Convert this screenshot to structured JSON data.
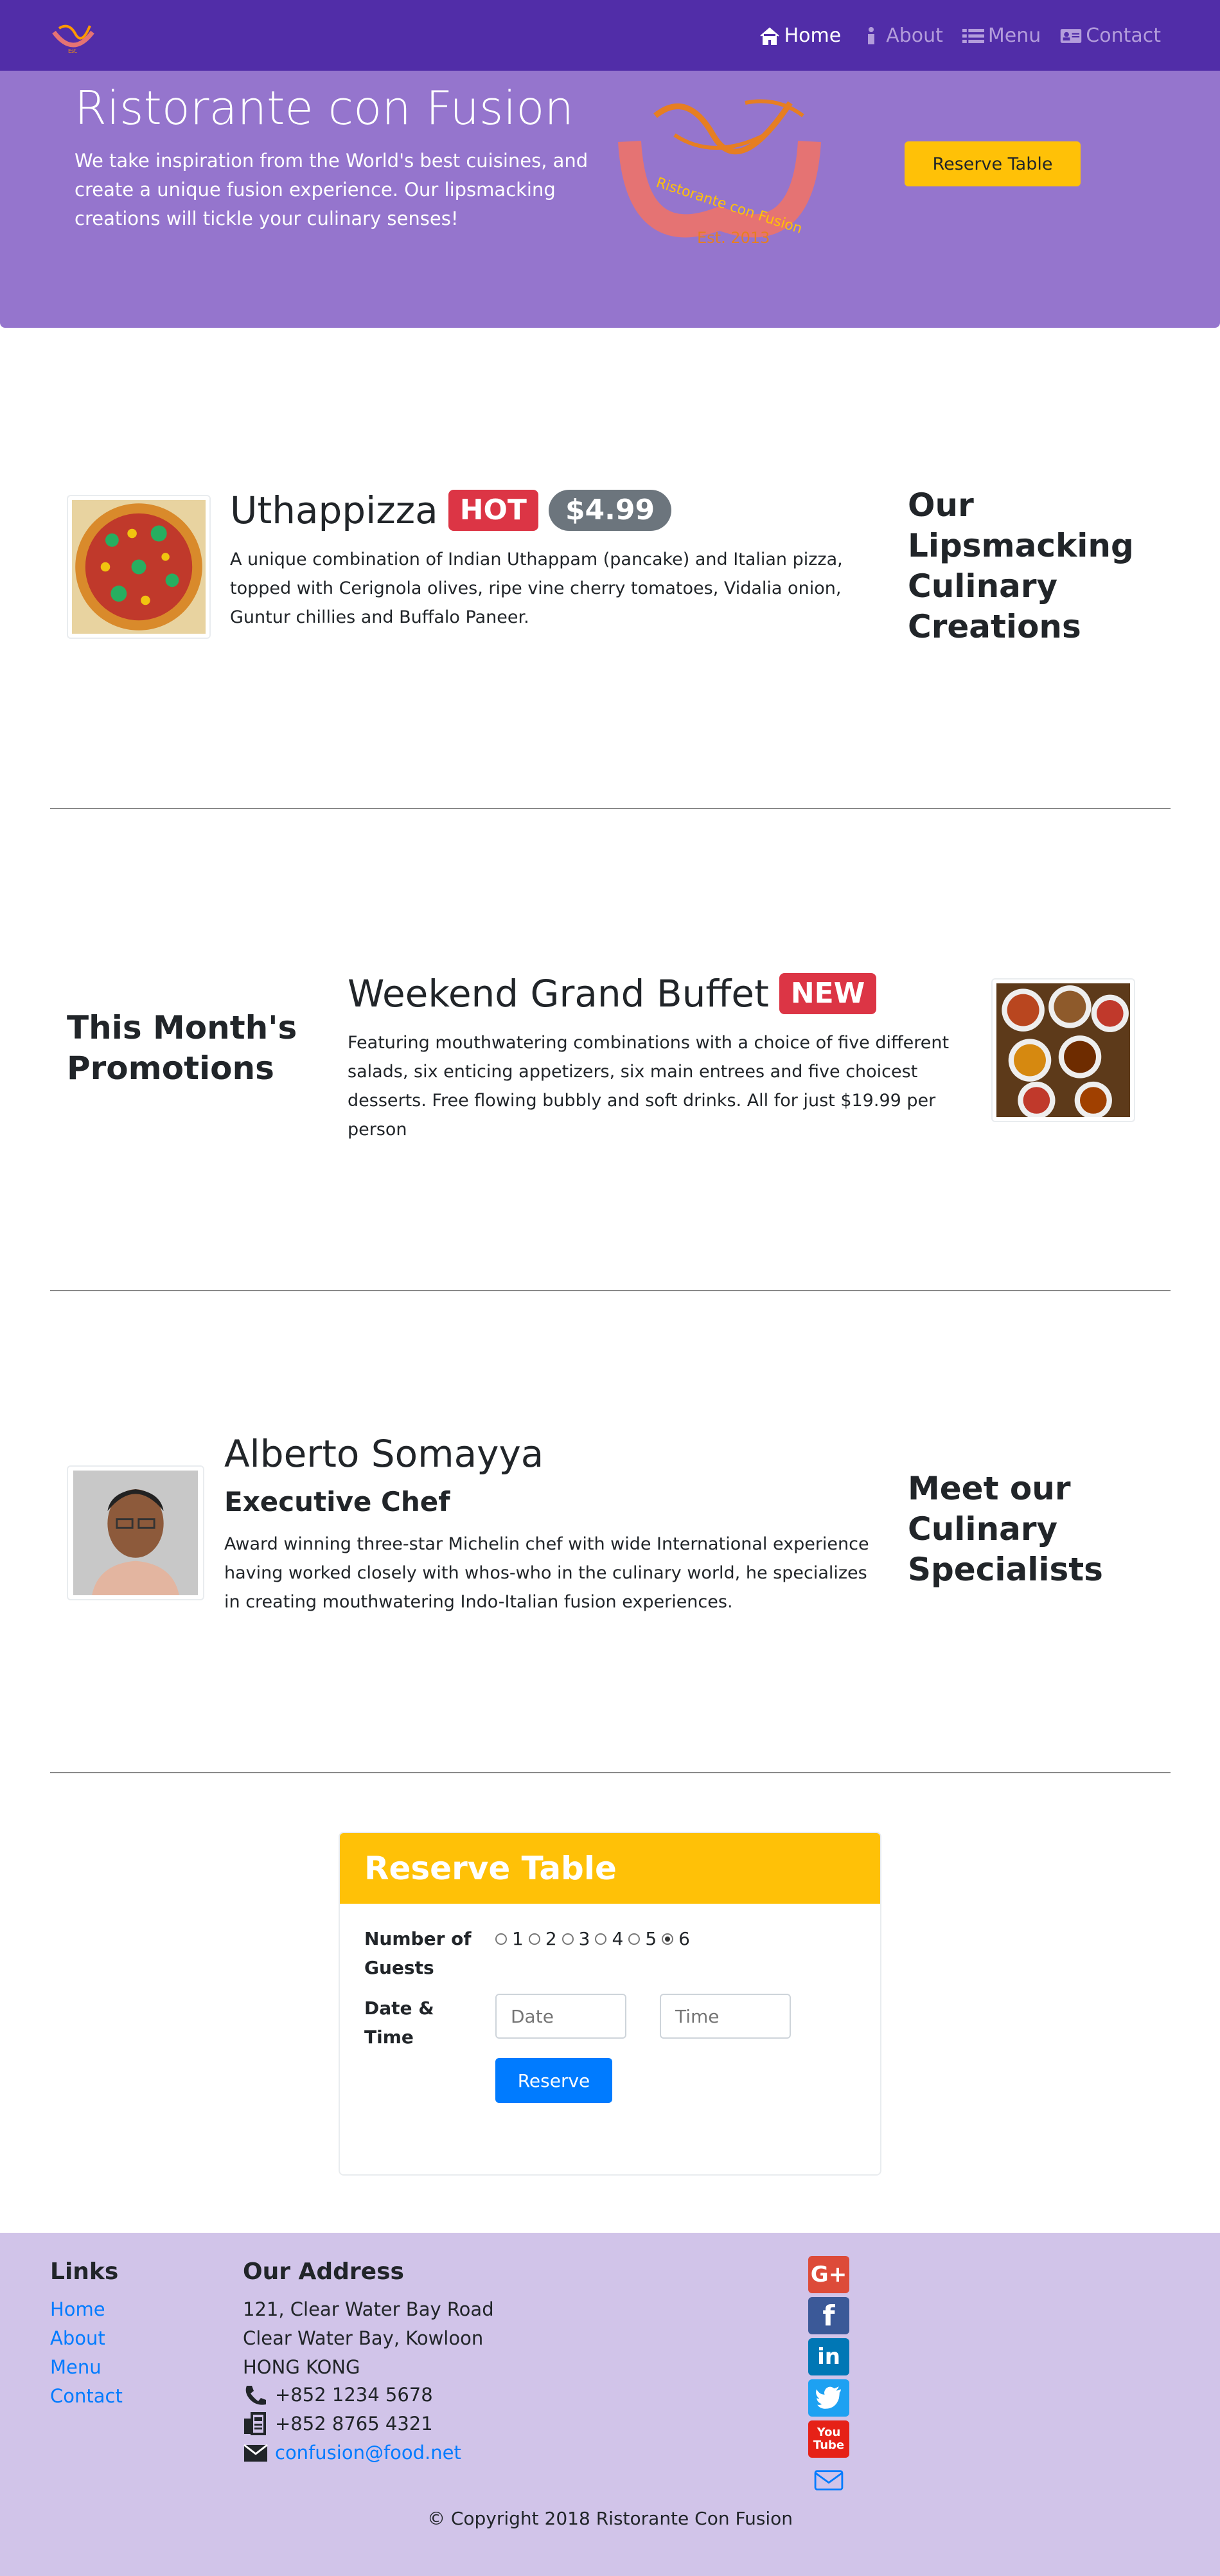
{
  "nav": {
    "logo_icon": "ristorante-logo",
    "items": [
      {
        "label": "Home",
        "icon": "home-icon",
        "active": true
      },
      {
        "label": "About",
        "icon": "info-icon",
        "active": false
      },
      {
        "label": "Menu",
        "icon": "list-icon",
        "active": false
      },
      {
        "label": "Contact",
        "icon": "address-card-icon",
        "active": false
      }
    ]
  },
  "jumbotron": {
    "title": "Ristorante con Fusion",
    "text": "We take inspiration from the World's best cuisines, and create a unique fusion experience. Our lipsmacking creations will tickle your culinary senses!",
    "logo_text": "Ristorante con Fusion",
    "logo_est": "Est. 2013",
    "button": "Reserve Table"
  },
  "dish": {
    "name": "Uthappizza",
    "badge": "HOT",
    "price": "$4.99",
    "description": "A unique combination of Indian Uthappam (pancake) and Italian pizza, topped with Cerignola olives, ripe vine cherry tomatoes, Vidalia onion, Guntur chillies and Buffalo Paneer.",
    "side_heading": "Our Lipsmacking Culinary Creations"
  },
  "promotion": {
    "side_heading": "This Month's Promotions",
    "name": "Weekend Grand Buffet",
    "badge": "NEW",
    "description": "Featuring mouthwatering combinations with a choice of five different salads, six enticing appetizers, six main entrees and five choicest desserts. Free flowing bubbly and soft drinks. All for just $19.99 per person"
  },
  "leader": {
    "name": "Alberto Somayya",
    "designation": "Executive Chef",
    "description": "Award winning three-star Michelin chef with wide International experience having worked closely with whos-who in the culinary world, he specializes in creating mouthwatering Indo-Italian fusion experiences.",
    "side_heading": "Meet our Culinary Specialists"
  },
  "reserve": {
    "title": "Reserve Table",
    "guests_label": "Number of Guests",
    "guest_options": [
      "1",
      "2",
      "3",
      "4",
      "5",
      "6"
    ],
    "guests_selected": "6",
    "datetime_label": "Date & Time",
    "date_placeholder": "Date",
    "time_placeholder": "Time",
    "submit": "Reserve"
  },
  "footer": {
    "links_heading": "Links",
    "links": [
      "Home",
      "About",
      "Menu",
      "Contact"
    ],
    "address_heading": "Our Address",
    "address": [
      "121, Clear Water Bay Road",
      "Clear Water Bay, Kowloon",
      "HONG KONG"
    ],
    "phone": "+852 1234 5678",
    "fax": "+852 8765 4321",
    "email": "confusion@food.net",
    "social": [
      "google-plus-icon",
      "facebook-icon",
      "linkedin-icon",
      "twitter-icon",
      "youtube-icon",
      "mail-icon"
    ],
    "social_labels": {
      "google": "G+",
      "facebook": "f",
      "linkedin": "in",
      "youtube_top": "You",
      "youtube_bottom": "Tube"
    },
    "copyright": "© Copyright 2018 Ristorante Con Fusion"
  },
  "colors": {
    "navbar": "#512da8",
    "jumbotron": "#9575cd",
    "footer": "#d1c4e9",
    "warning": "#ffc107",
    "primary": "#007bff",
    "danger": "#dc3545"
  }
}
